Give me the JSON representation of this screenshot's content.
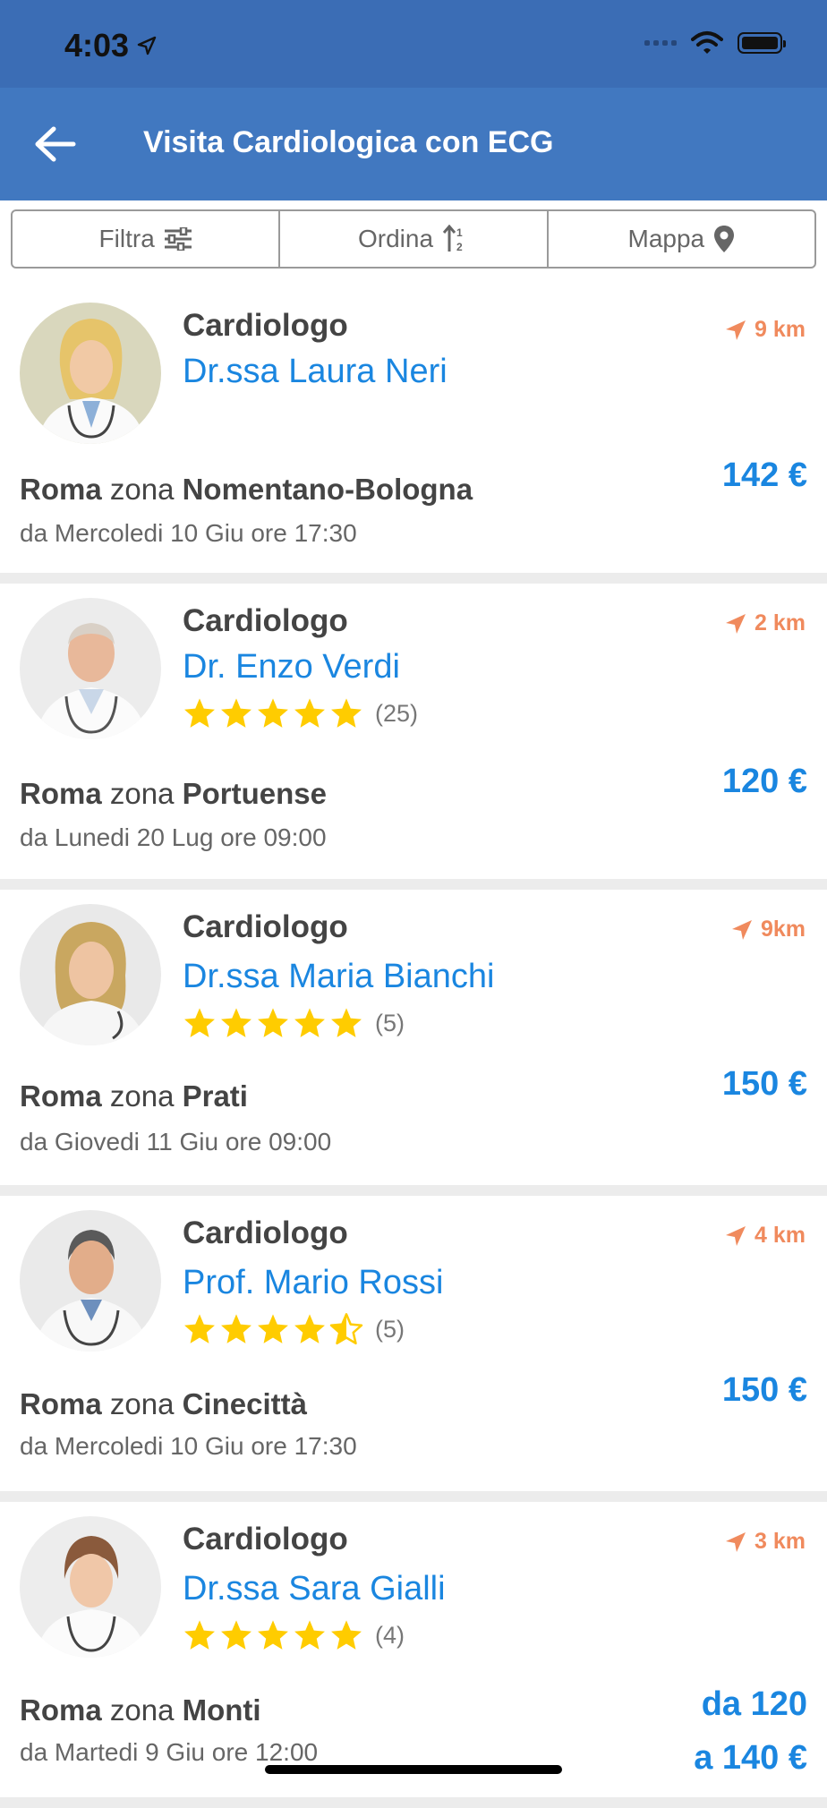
{
  "status": {
    "time": "4:03"
  },
  "header": {
    "title": "Visita Cardiologica con ECG"
  },
  "toolbar": {
    "filter_label": "Filtra",
    "sort_label": "Ordina",
    "map_label": "Mappa"
  },
  "results": [
    {
      "specialty": "Cardiologo",
      "name": "Dr.ssa Laura Neri",
      "distance": "9 km",
      "city": "Roma",
      "zone_word": "zona",
      "zone": "Nomentano-Bologna",
      "availability": "da Mercoledi 10 Giu ore 17:30",
      "price": "142 €"
    },
    {
      "specialty": "Cardiologo",
      "name": "Dr. Enzo Verdi",
      "rating": 5,
      "reviews": "(25)",
      "distance": "2 km",
      "city": "Roma",
      "zone_word": "zona",
      "zone": "Portuense",
      "availability": "da Lunedi 20 Lug ore 09:00",
      "price": "120 €"
    },
    {
      "specialty": "Cardiologo",
      "name": "Dr.ssa Maria Bianchi",
      "rating": 5,
      "reviews": "(5)",
      "distance": "9km",
      "city": "Roma",
      "zone_word": "zona",
      "zone": "Prati",
      "availability": "da Giovedi 11 Giu ore 09:00",
      "price": "150 €"
    },
    {
      "specialty": "Cardiologo",
      "name": "Prof. Mario Rossi",
      "rating": 4.5,
      "reviews": "(5)",
      "distance": "4 km",
      "city": "Roma",
      "zone_word": "zona",
      "zone": "Cinecittà",
      "availability": "da Mercoledi 10 Giu ore 17:30",
      "price": "150 €"
    },
    {
      "specialty": "Cardiologo",
      "name": "Dr.ssa Sara Gialli",
      "rating": 5,
      "reviews": "(4)",
      "distance": "3 km",
      "city": "Roma",
      "zone_word": "zona",
      "zone": "Monti",
      "availability": "da Martedi 9 Giu ore 12:00",
      "price_line1": "da 120",
      "price_line2": "a 140 €"
    }
  ],
  "colors": {
    "header": "#4178c0",
    "status_bar": "#3b6db5",
    "link_blue": "#1a86e0",
    "distance_orange": "#f08a5d",
    "star_yellow": "#ffcc00"
  }
}
